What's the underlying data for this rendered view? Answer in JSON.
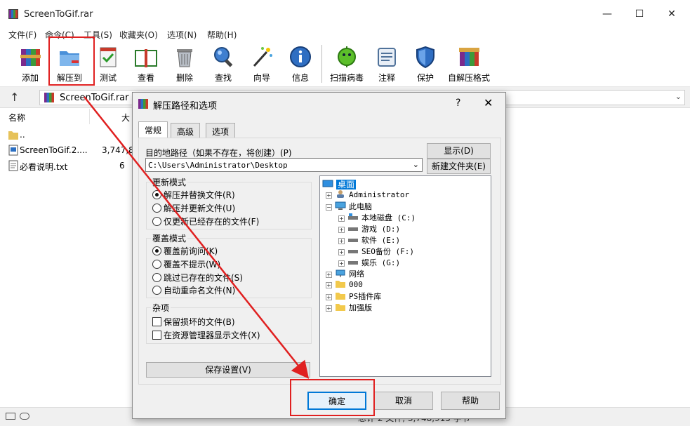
{
  "window": {
    "title": "ScreenToGif.rar",
    "controls": {
      "minimize": "—",
      "maximize": "☐",
      "close": "✕"
    }
  },
  "menu": [
    "文件(F)",
    "命令(C)",
    "工具(S)",
    "收藏夹(O)",
    "选项(N)",
    "帮助(H)"
  ],
  "toolbar": [
    {
      "label": "添加",
      "icon": "add-icon"
    },
    {
      "label": "解压到",
      "icon": "extract-to-icon"
    },
    {
      "label": "测试",
      "icon": "test-icon"
    },
    {
      "label": "查看",
      "icon": "view-icon"
    },
    {
      "label": "删除",
      "icon": "delete-icon"
    },
    {
      "label": "查找",
      "icon": "find-icon"
    },
    {
      "label": "向导",
      "icon": "wizard-icon"
    },
    {
      "label": "信息",
      "icon": "info-icon"
    },
    {
      "label": "扫描病毒",
      "icon": "virus-scan-icon"
    },
    {
      "label": "注释",
      "icon": "comment-icon"
    },
    {
      "label": "保护",
      "icon": "protect-icon"
    },
    {
      "label": "自解压格式",
      "icon": "sfx-icon"
    }
  ],
  "address": {
    "path": "ScreenToGif.rar -"
  },
  "file_list": {
    "columns": [
      "名称",
      "大"
    ],
    "rows": [
      {
        "name": "..",
        "size": ""
      },
      {
        "name": "ScreenToGif.2....",
        "size": "3,747,8"
      },
      {
        "name": "必看说明.txt",
        "size": "6"
      }
    ]
  },
  "status": {
    "text": "总计 2 文件, 3,748,915 字节"
  },
  "dialog": {
    "title": "解压路径和选项",
    "help": "?",
    "close": "✕",
    "tabs": [
      "常规",
      "高级",
      "选项"
    ],
    "active_tab": "常规",
    "dest_label": "目的地路径（如果不存在，将创建）(P)",
    "dest_path": "C:\\Users\\Administrator\\Desktop",
    "show_button": "显示(D)",
    "new_folder_button": "新建文件夹(E)",
    "update_mode": {
      "title": "更新模式",
      "options": [
        "解压并替换文件(R)",
        "解压并更新文件(U)",
        "仅更新已经存在的文件(F)"
      ],
      "selected": 0
    },
    "overwrite_mode": {
      "title": "覆盖模式",
      "options": [
        "覆盖前询问(K)",
        "覆盖不提示(W)",
        "跳过已存在的文件(S)",
        "自动重命名文件(N)"
      ],
      "selected": 0
    },
    "misc": {
      "title": "杂项",
      "options": [
        "保留损坏的文件(B)",
        "在资源管理器显示文件(X)"
      ]
    },
    "save_settings": "保存设置(V)",
    "tree": [
      {
        "label": "桌面",
        "level": 0,
        "icon": "desktop-icon",
        "expander": ""
      },
      {
        "label": "Administrator",
        "level": 1,
        "icon": "user-icon",
        "expander": "+"
      },
      {
        "label": "此电脑",
        "level": 1,
        "icon": "computer-icon",
        "expander": "−"
      },
      {
        "label": "本地磁盘 (C:)",
        "level": 2,
        "icon": "system-drive-icon",
        "expander": "+"
      },
      {
        "label": "游戏 (D:)",
        "level": 2,
        "icon": "drive-icon",
        "expander": "+"
      },
      {
        "label": "软件 (E:)",
        "level": 2,
        "icon": "drive-icon",
        "expander": "+"
      },
      {
        "label": "SEO备份 (F:)",
        "level": 2,
        "icon": "drive-icon",
        "expander": "+"
      },
      {
        "label": "娱乐 (G:)",
        "level": 2,
        "icon": "drive-icon",
        "expander": "+"
      },
      {
        "label": "网络",
        "level": 1,
        "icon": "network-icon",
        "expander": "+"
      },
      {
        "label": "000",
        "level": 1,
        "icon": "folder-icon",
        "expander": "+"
      },
      {
        "label": "PS插件库",
        "level": 1,
        "icon": "folder-icon",
        "expander": "+"
      },
      {
        "label": "加强版",
        "level": 1,
        "icon": "folder-icon",
        "expander": "+"
      }
    ],
    "buttons": {
      "ok": "确定",
      "cancel": "取消",
      "help": "帮助"
    }
  },
  "colors": {
    "annotation": "#e02020",
    "selection": "#0078d7"
  }
}
